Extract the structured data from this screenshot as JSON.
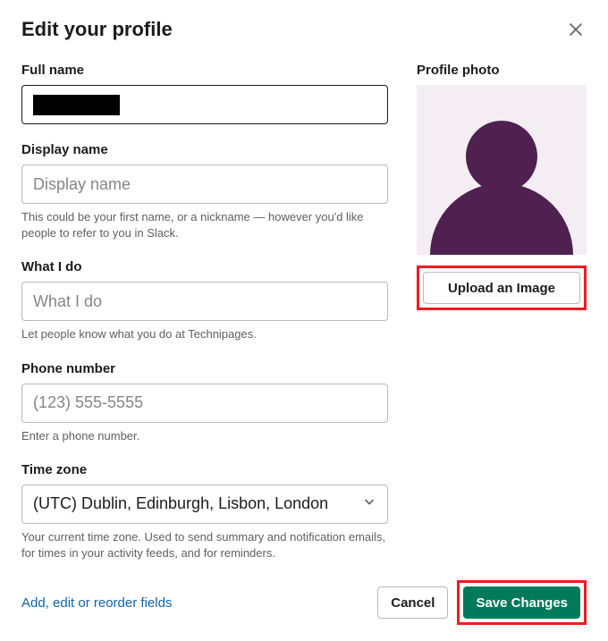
{
  "header": {
    "title": "Edit your profile"
  },
  "fields": {
    "full_name": {
      "label": "Full name"
    },
    "display_name": {
      "label": "Display name",
      "placeholder": "Display name",
      "helper": "This could be your first name, or a nickname — however you'd like people to refer to you in Slack."
    },
    "what_i_do": {
      "label": "What I do",
      "placeholder": "What I do",
      "helper": "Let people know what you do at Technipages."
    },
    "phone": {
      "label": "Phone number",
      "placeholder": "(123) 555-5555",
      "helper": "Enter a phone number."
    },
    "timezone": {
      "label": "Time zone",
      "value": "(UTC) Dublin, Edinburgh, Lisbon, London",
      "helper": "Your current time zone. Used to send summary and notification emails, for times in your activity feeds, and for reminders."
    }
  },
  "photo": {
    "label": "Profile photo",
    "upload_label": "Upload an Image"
  },
  "footer": {
    "reorder_link": "Add, edit or reorder fields",
    "cancel": "Cancel",
    "save": "Save Changes"
  },
  "colors": {
    "accent": "#007a5a",
    "highlight_border": "#ed1c24",
    "avatar_fill": "#4f2050",
    "avatar_bg": "#f4eef4"
  }
}
